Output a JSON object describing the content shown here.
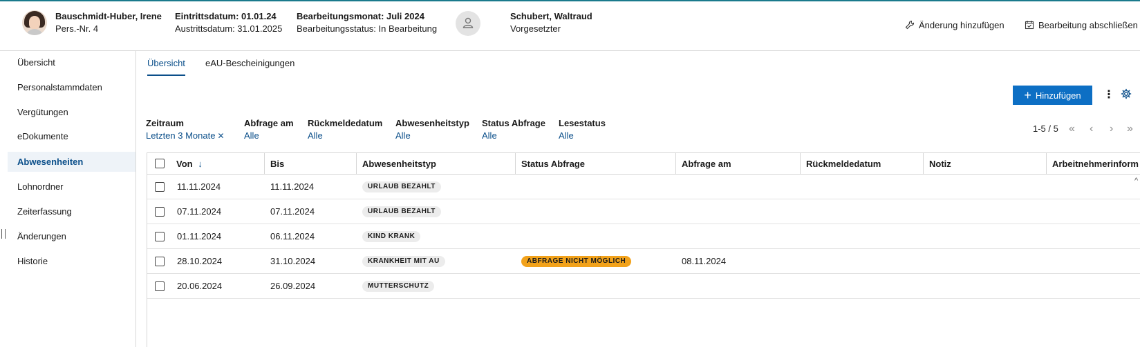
{
  "header": {
    "employee_name": "Bauschmidt-Huber, Irene",
    "personnel_number": "Pers.-Nr. 4",
    "entry_date": "Eintrittsdatum: 01.01.24",
    "exit_date": "Austrittsdatum: 31.01.2025",
    "processing_month": "Bearbeitungsmonat: Juli 2024",
    "processing_status": "Bearbeitungsstatus: In Bearbeitung",
    "supervisor_name": "Schubert, Waltraud",
    "supervisor_role": "Vorgesetzter",
    "add_change_label": "Änderung hinzufügen",
    "finish_label": "Bearbeitung abschließen"
  },
  "sidebar": {
    "items": [
      {
        "label": "Übersicht",
        "active": false
      },
      {
        "label": "Personalstammdaten",
        "active": false
      },
      {
        "label": "Vergütungen",
        "active": false
      },
      {
        "label": "eDokumente",
        "active": false
      },
      {
        "label": "Abwesenheiten",
        "active": true
      },
      {
        "label": "Lohnordner",
        "active": false
      },
      {
        "label": "Zeiterfassung",
        "active": false
      },
      {
        "label": "Änderungen",
        "active": false
      },
      {
        "label": "Historie",
        "active": false
      }
    ]
  },
  "tabs": [
    {
      "label": "Übersicht",
      "active": true
    },
    {
      "label": "eAU-Bescheinigungen",
      "active": false
    }
  ],
  "toolbar": {
    "add_label": "Hinzufügen",
    "kebab_glyph": "⋮"
  },
  "filters": [
    {
      "label": "Zeitraum",
      "value": "Letzten 3 Monate",
      "clearable": true
    },
    {
      "label": "Abfrage am",
      "value": "Alle"
    },
    {
      "label": "Rückmeldedatum",
      "value": "Alle"
    },
    {
      "label": "Abwesenheitstyp",
      "value": "Alle"
    },
    {
      "label": "Status Abfrage",
      "value": "Alle"
    },
    {
      "label": "Lesestatus",
      "value": "Alle"
    }
  ],
  "pager": {
    "range": "1-5 / 5"
  },
  "table": {
    "columns": [
      "Von",
      "Bis",
      "Abwesenheitstyp",
      "Status Abfrage",
      "Abfrage am",
      "Rückmeldedatum",
      "Notiz",
      "Arbeitnehmerinform"
    ],
    "sort_glyph": "↓",
    "rows": [
      {
        "von": "11.11.2024",
        "bis": "11.11.2024",
        "typ": "URLAUB BEZAHLT",
        "status": "",
        "abfrage": ""
      },
      {
        "von": "07.11.2024",
        "bis": "07.11.2024",
        "typ": "URLAUB BEZAHLT",
        "status": "",
        "abfrage": ""
      },
      {
        "von": "01.11.2024",
        "bis": "06.11.2024",
        "typ": "KIND KRANK",
        "status": "",
        "abfrage": ""
      },
      {
        "von": "28.10.2024",
        "bis": "31.10.2024",
        "typ": "KRANKHEIT MIT AU",
        "status": "ABFRAGE NICHT MÖGLICH",
        "abfrage": "08.11.2024"
      },
      {
        "von": "20.06.2024",
        "bis": "26.09.2024",
        "typ": "MUTTERSCHUTZ",
        "status": "",
        "abfrage": ""
      }
    ]
  },
  "colors": {
    "accent": "#0d6fc4",
    "link": "#0b4f8a",
    "warning_badge": "#f2a21b",
    "neutral_badge": "#ececec"
  }
}
